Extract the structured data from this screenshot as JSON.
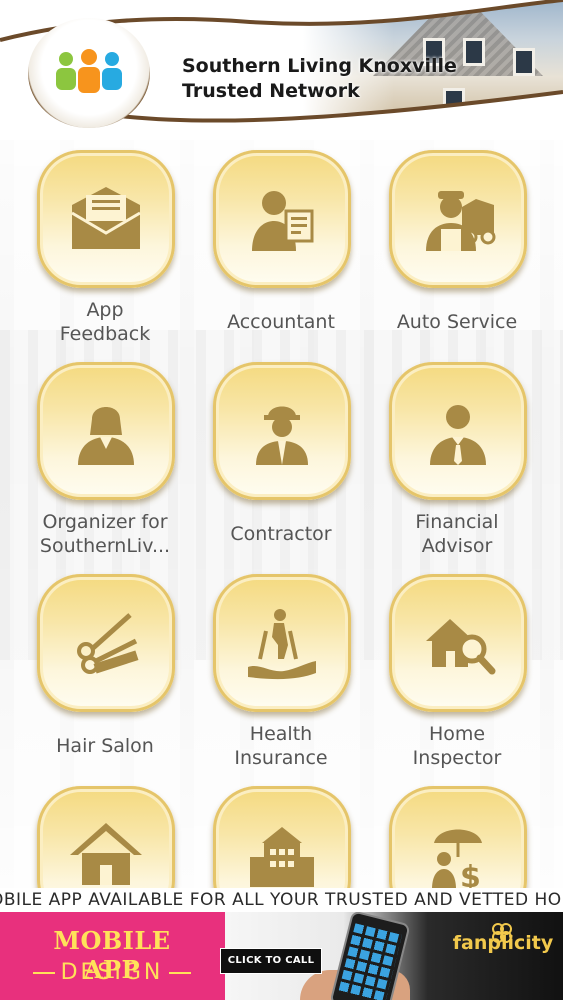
{
  "header": {
    "title_line1": "Southern Living Knoxville",
    "title_line2": "Trusted Network",
    "logo_icon": "people-group-icon"
  },
  "tiles": [
    {
      "label": "App Feedback",
      "label_lines": [
        "App",
        "Feedback"
      ],
      "icon": "envelope-icon"
    },
    {
      "label": "Accountant",
      "label_lines": [
        "Accountant"
      ],
      "icon": "accountant-icon"
    },
    {
      "label": "Auto Service",
      "label_lines": [
        "Auto Service"
      ],
      "icon": "mechanic-icon"
    },
    {
      "label": "Organizer for SouthernLiv...",
      "label_lines": [
        "Organizer for",
        "SouthernLiv..."
      ],
      "icon": "woman-icon"
    },
    {
      "label": "Contractor",
      "label_lines": [
        "Contractor"
      ],
      "icon": "hardhat-worker-icon"
    },
    {
      "label": "Financial Advisor",
      "label_lines": [
        "Financial",
        "Advisor"
      ],
      "icon": "businessman-icon"
    },
    {
      "label": "Hair Salon",
      "label_lines": [
        "Hair Salon"
      ],
      "icon": "scissors-comb-icon"
    },
    {
      "label": "Health Insurance",
      "label_lines": [
        "Health",
        "Insurance"
      ],
      "icon": "elderly-care-icon"
    },
    {
      "label": "Home Inspector",
      "label_lines": [
        "Home",
        "Inspector"
      ],
      "icon": "house-magnifier-icon"
    },
    {
      "label": "",
      "label_lines": [],
      "icon": "house-icon"
    },
    {
      "label": "",
      "label_lines": [],
      "icon": "building-icon"
    },
    {
      "label": "",
      "label_lines": [],
      "icon": "insurance-umbrella-icon"
    }
  ],
  "ticker": {
    "text": "OBILE APP AVAILABLE FOR ALL YOUR TRUSTED AND VETTED HO"
  },
  "ad": {
    "title": "MOBILE APP",
    "subtitle": "DESIGN",
    "cta": "CLICK TO CALL",
    "brand": "fanplicity",
    "colors": {
      "background": "#e52b7a",
      "text": "#ffe15a",
      "brand": "#f2c94c"
    }
  },
  "colors": {
    "tile_gold": "#f4d97e",
    "tile_icon": "#b08d3c",
    "label": "#555555"
  }
}
